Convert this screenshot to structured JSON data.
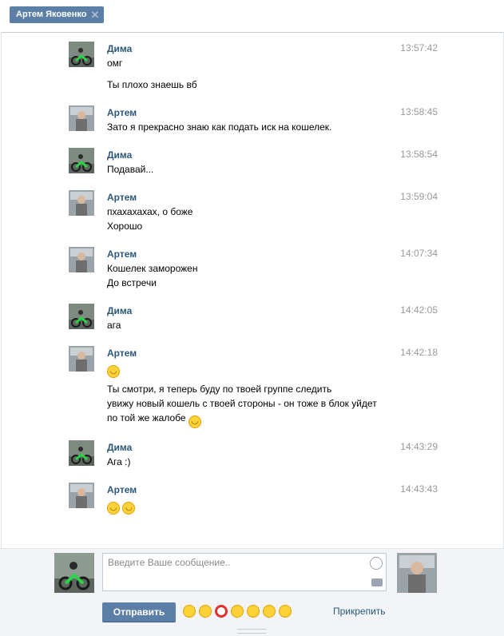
{
  "header": {
    "tab_title": "Артем Яковенко",
    "close_glyph": "✕"
  },
  "users": {
    "dima": {
      "name": "Дима",
      "avatar": "motorcycle-photo"
    },
    "artem": {
      "name": "Артем",
      "avatar": "person-photo"
    }
  },
  "messages": [
    {
      "author": "Дима",
      "time": "13:57:42",
      "lines": [
        "омг",
        "Ты плохо знаешь вб"
      ]
    },
    {
      "author": "Артем",
      "time": "13:58:45",
      "lines": [
        "Зато я прекрасно знаю как подать иск на кошелек."
      ]
    },
    {
      "author": "Дима",
      "time": "13:58:54",
      "lines": [
        "Подавай..."
      ]
    },
    {
      "author": "Артем",
      "time": "13:59:04",
      "lines": [
        "пхахахахах, о боже",
        "Хорошо"
      ]
    },
    {
      "author": "Артем",
      "time": "14:07:34",
      "lines": [
        "Кошелек заморожен",
        "До встречи"
      ]
    },
    {
      "author": "Дима",
      "time": "14:42:05",
      "lines": [
        "ага"
      ]
    },
    {
      "author": "Артем",
      "time": "14:42:18",
      "lines": [
        "Ты смотри, я теперь буду по твоей группе следить",
        "увижу новый кошель с твоей стороны - он тоже в блок уйдет",
        "по той же жалобе"
      ]
    },
    {
      "author": "Дима",
      "time": "14:43:29",
      "lines": [
        "Ага :)"
      ]
    },
    {
      "author": "Артем",
      "time": "14:43:43",
      "lines": []
    }
  ],
  "composer": {
    "placeholder": "Введите Ваше сообщение..",
    "send_label": "Отправить",
    "attach_label": "Прикрепить",
    "quick_emoji": [
      "ok-hand-icon",
      "surprised-icon",
      "red-circle-icon",
      "thumbs-up-icon",
      "sunglasses-icon",
      "grin-icon",
      "smile-icon"
    ]
  },
  "colors": {
    "accent": "#5b7fa6",
    "author": "#2b587a",
    "time": "#999999",
    "footer_bg": "#f2f4f7"
  }
}
